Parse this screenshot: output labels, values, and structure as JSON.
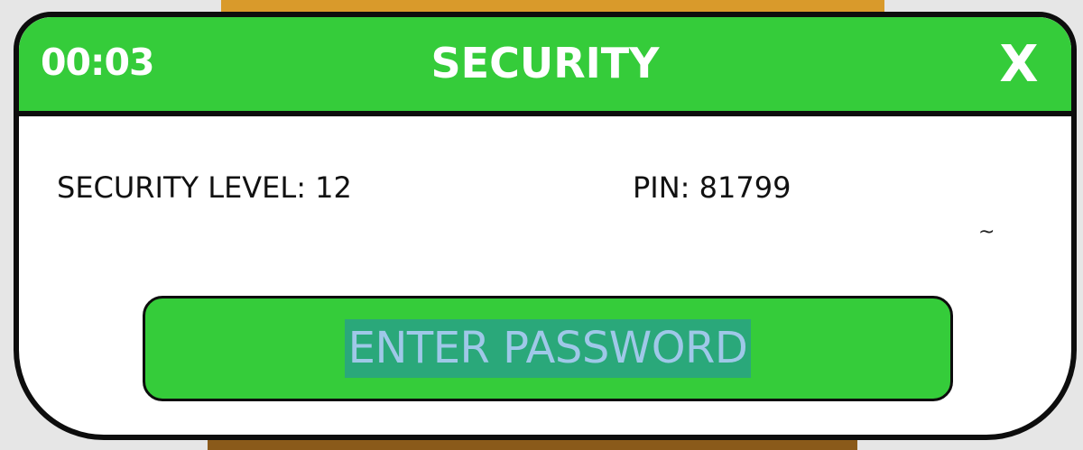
{
  "dialog": {
    "timer": "00:03",
    "title": "SECURITY",
    "close_label": "X"
  },
  "info": {
    "security_level": "SECURITY LEVEL: 12",
    "pin": "PIN: 81799",
    "tilde": "~"
  },
  "action": {
    "enter_password_label": "ENTER PASSWORD"
  },
  "colors": {
    "titlebar": "#35cc3a",
    "button": "#35cc3a",
    "selection_bg": "#2aa87a",
    "selection_text": "#9fc8e8",
    "border": "#0d0d0d"
  }
}
